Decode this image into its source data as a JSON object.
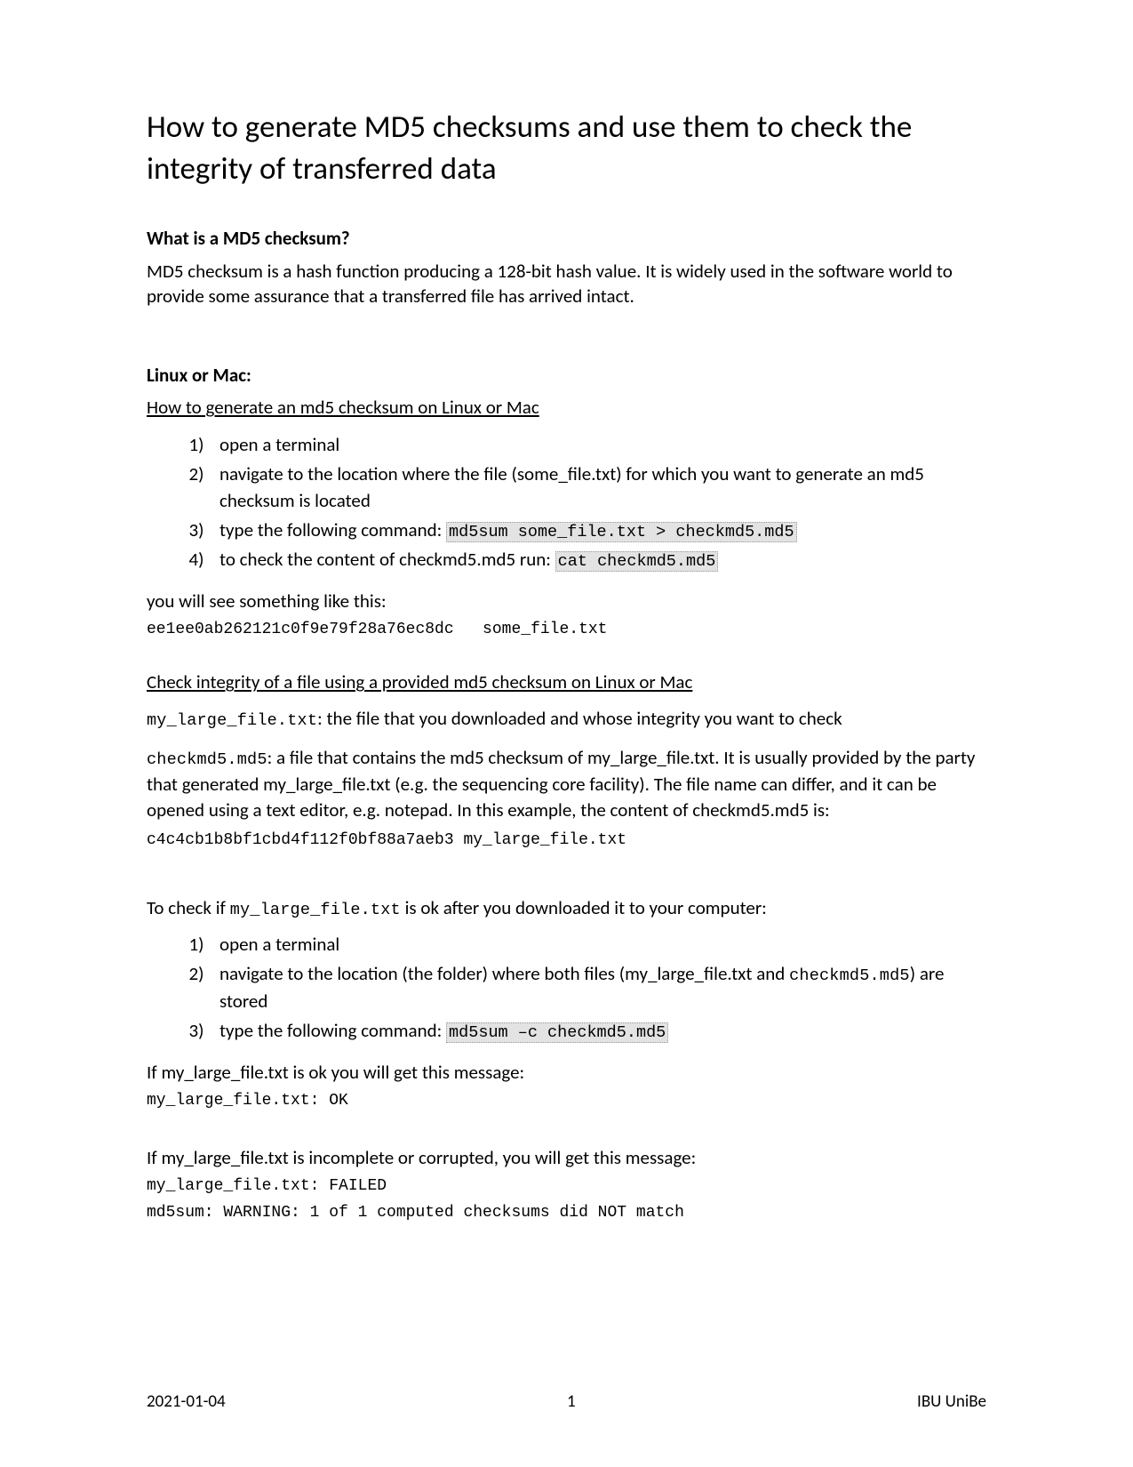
{
  "title": "How to generate MD5 checksums and use them to check the integrity of transferred data",
  "s1": {
    "heading": "What is a MD5 checksum?",
    "p1": "MD5 checksum is a hash function producing a 128-bit hash value. It is widely used in the software world to provide some assurance that a transferred file has arrived intact."
  },
  "s2": {
    "heading": "Linux or Mac:",
    "sub1": "How to generate an md5 checksum on Linux or Mac",
    "gen_steps": {
      "i1": "open a terminal",
      "i2": "navigate to the location where the file (some_file.txt) for which you want to generate an md5 checksum is located",
      "i3_pre": "type the following command: ",
      "i3_cmd": "md5sum some_file.txt > checkmd5.md5",
      "i4_pre": "to check the content of checkmd5.md5 run: ",
      "i4_cmd": "cat  checkmd5.md5"
    },
    "p_after_gen": "you will see something like this:",
    "code_gen": "ee1ee0ab262121c0f9e79f28a76ec8dc   some_file.txt",
    "sub2": "Check integrity of a file using a provided md5 checksum on Linux or Mac",
    "p_large_pre": "my_large_file.txt",
    "p_large_rest": ": the file that you downloaded and whose integrity you want to check",
    "p_check_pre": "checkmd5.md5",
    "p_check_rest": ": a file that contains the md5 checksum of my_large_file.txt. It is usually provided by the party that generated my_large_file.txt (e.g. the sequencing core facility). The file name can differ, and it can be opened using a text editor, e.g. notepad. In this example, the content of checkmd5.md5 is:",
    "code_check": "c4c4cb1b8bf1cbd4f112f0bf88a7aeb3 my_large_file.txt",
    "p_tocheck_pre": "To check if ",
    "p_tocheck_mono": "my_large_file.txt",
    "p_tocheck_rest": " is ok after you downloaded it to your computer:",
    "verify_steps": {
      "i1": "open a terminal",
      "i2_a": "navigate to the location (the folder) where both files (my_large_file.txt and ",
      "i2_mono": "checkmd5.md5",
      "i2_b": ") are stored",
      "i3_pre": "type the following command: ",
      "i3_cmd": "md5sum –c checkmd5.md5"
    },
    "p_ok": "If my_large_file.txt is ok you will get this message:",
    "code_ok": "my_large_file.txt: OK",
    "p_fail": "If my_large_file.txt is incomplete or corrupted, you will get this message:",
    "code_fail1": "my_large_file.txt: FAILED",
    "code_fail2": "md5sum: WARNING: 1 of 1 computed checksums did NOT match"
  },
  "footer": {
    "date": "2021-01-04",
    "page": "1",
    "org": "IBU UniBe"
  }
}
